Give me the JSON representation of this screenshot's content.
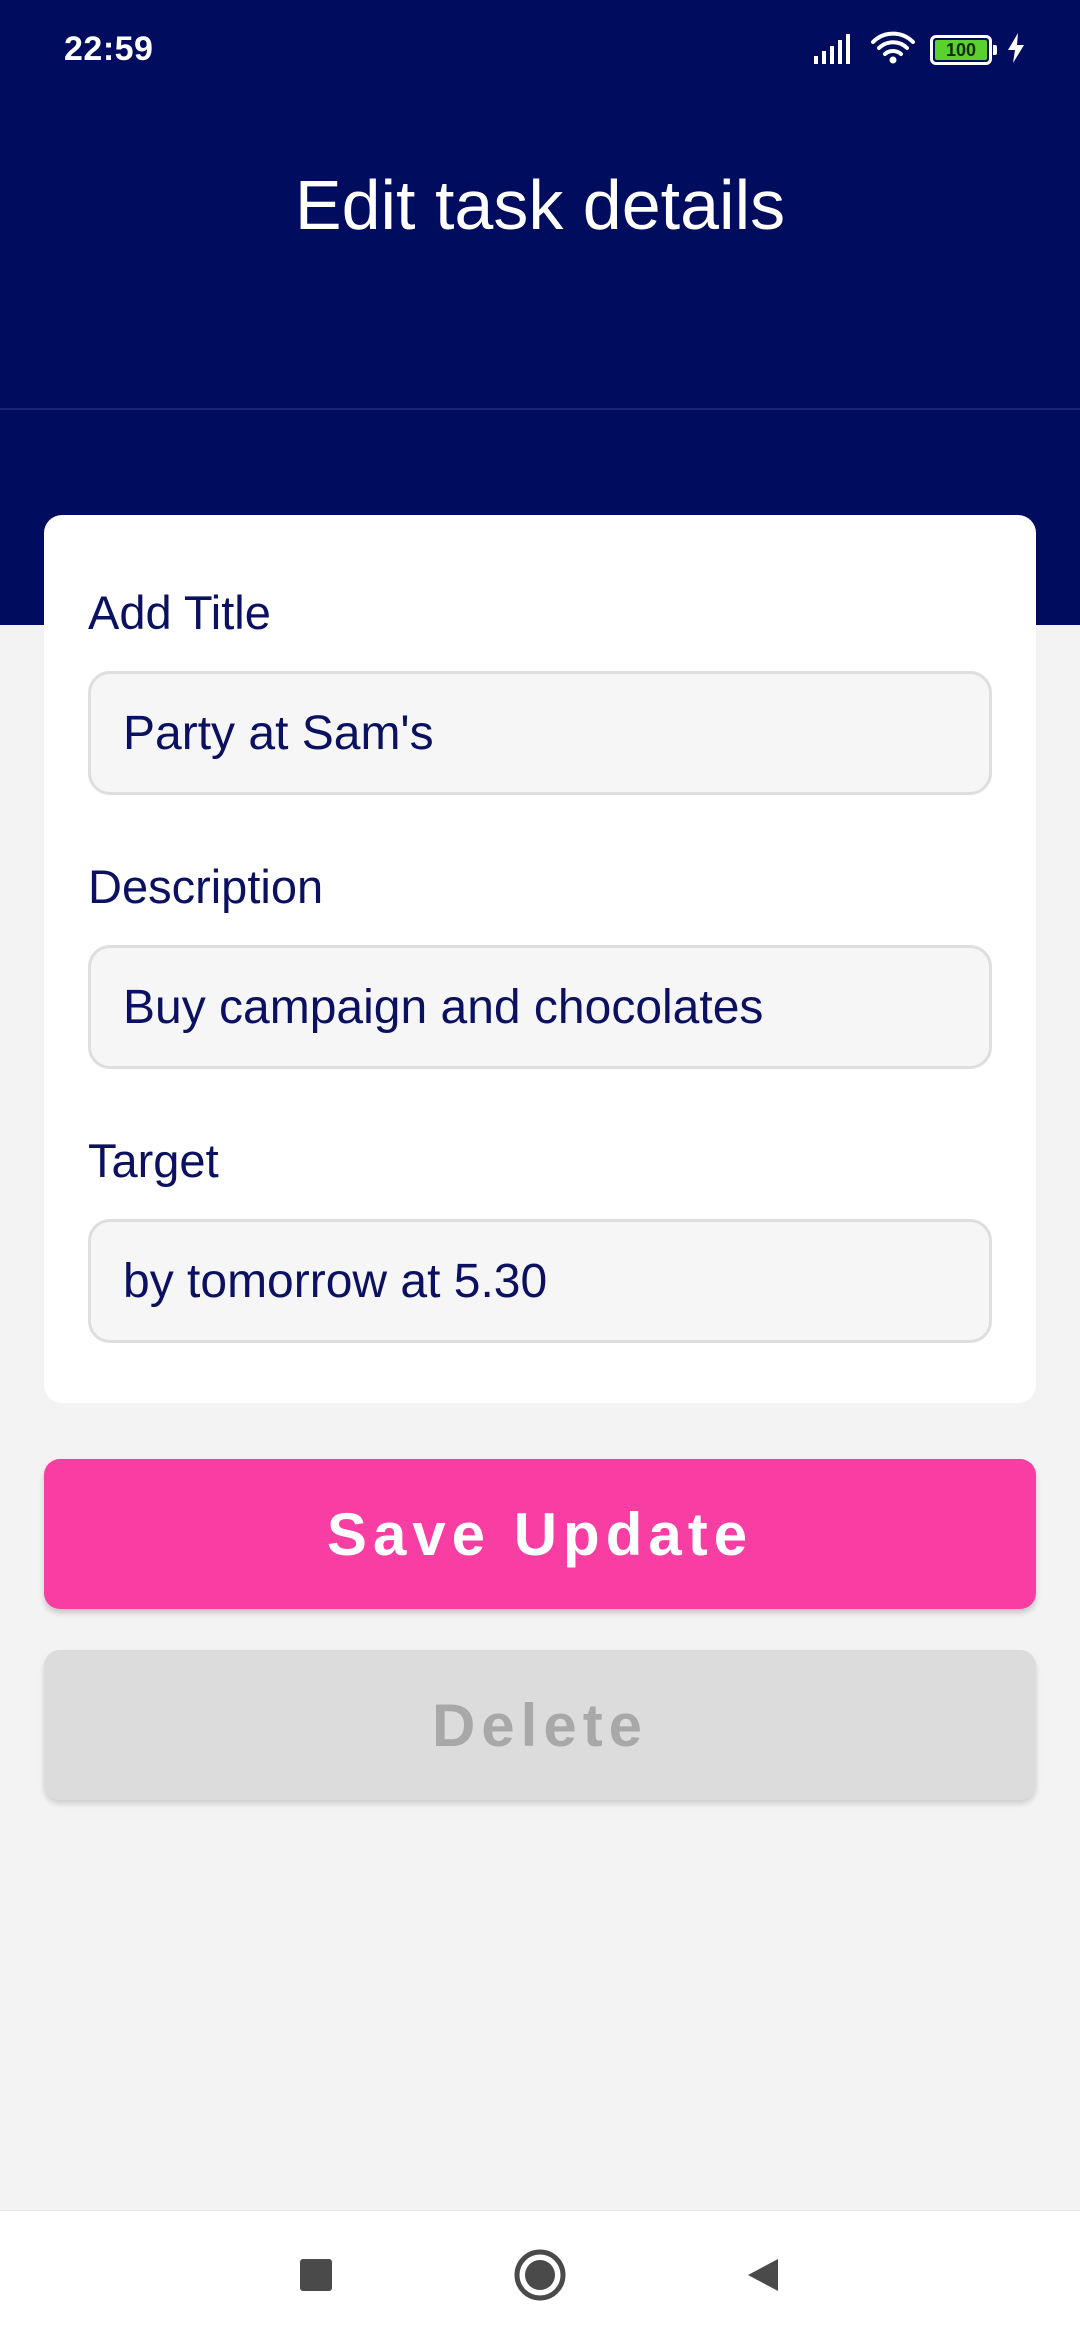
{
  "status_bar": {
    "time": "22:59",
    "battery_level": "100",
    "icons": [
      "signal-icon",
      "wifi-icon",
      "battery-icon",
      "charging-icon"
    ]
  },
  "header": {
    "title": "Edit task details"
  },
  "form": {
    "title_label": "Add Title",
    "title_value": "Party at Sam's",
    "description_label": "Description",
    "description_value": "Buy campaign and chocolates",
    "target_label": "Target",
    "target_value": "by tomorrow at 5.30"
  },
  "actions": {
    "save_label": "Save Update",
    "delete_label": "Delete"
  },
  "nav": {
    "icons": [
      "recents-square-icon",
      "home-circle-icon",
      "back-triangle-icon"
    ]
  },
  "colors": {
    "header_bg": "#000c5e",
    "accent_pink": "#f83da3",
    "text_navy": "#0b1160",
    "disabled_gray": "#dcdcdc"
  }
}
